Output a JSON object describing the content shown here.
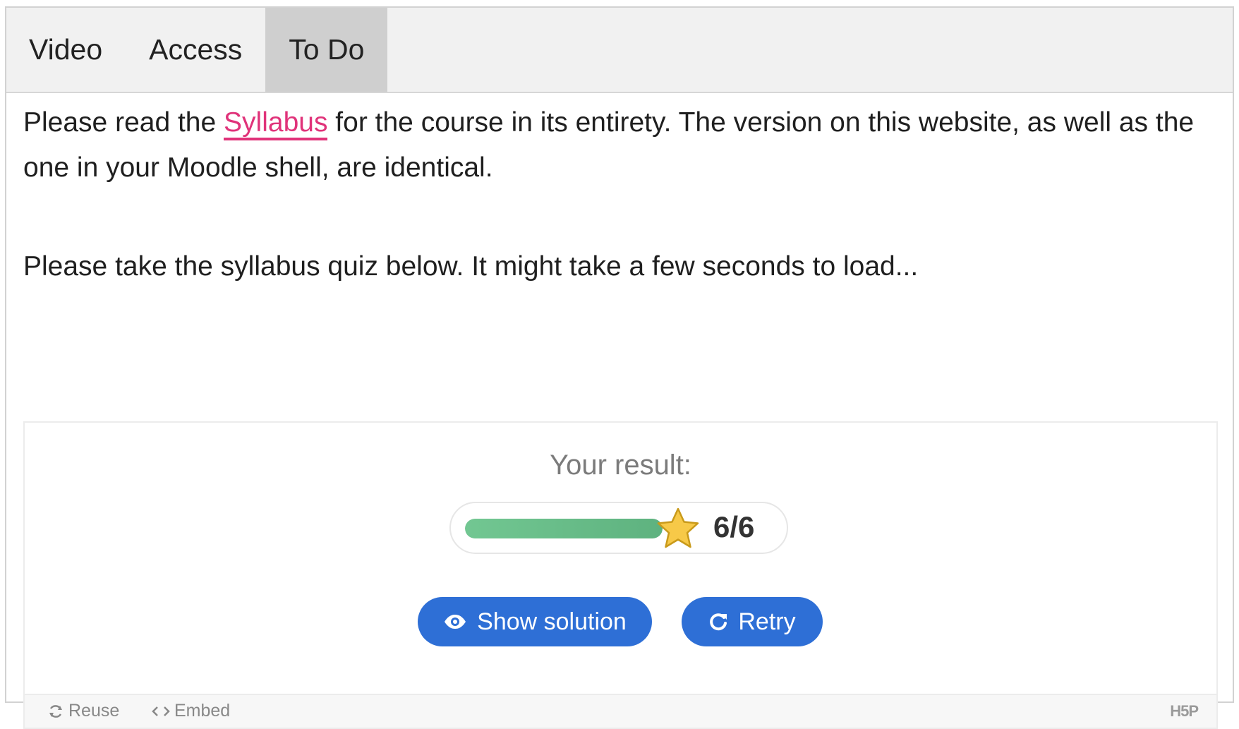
{
  "tabs": [
    {
      "label": "Video",
      "active": false
    },
    {
      "label": "Access",
      "active": false
    },
    {
      "label": "To Do",
      "active": true
    }
  ],
  "content": {
    "p1_before": "Please read the ",
    "p1_link": "Syllabus",
    "p1_after": " for the course in its entirety. The version on this website, as well as the one in your Moodle shell, are identical.",
    "p2": "Please take the syllabus quiz below. It might take a few seconds to load..."
  },
  "quiz": {
    "result_title": "Your result:",
    "score_text": "6/6",
    "score_fraction": 1.0,
    "show_solution_label": "Show solution",
    "retry_label": "Retry"
  },
  "footer": {
    "reuse_label": "Reuse",
    "embed_label": "Embed",
    "logo_text": "H5P"
  },
  "colors": {
    "accent_link": "#e0337a",
    "button_blue": "#2e6fd6",
    "progress_green": "#6cbf8b",
    "star_gold": "#f7c948"
  },
  "icons": {
    "show_solution": "eye-icon",
    "retry": "retry-icon",
    "reuse": "reuse-icon",
    "embed": "embed-icon",
    "score": "star-icon"
  }
}
